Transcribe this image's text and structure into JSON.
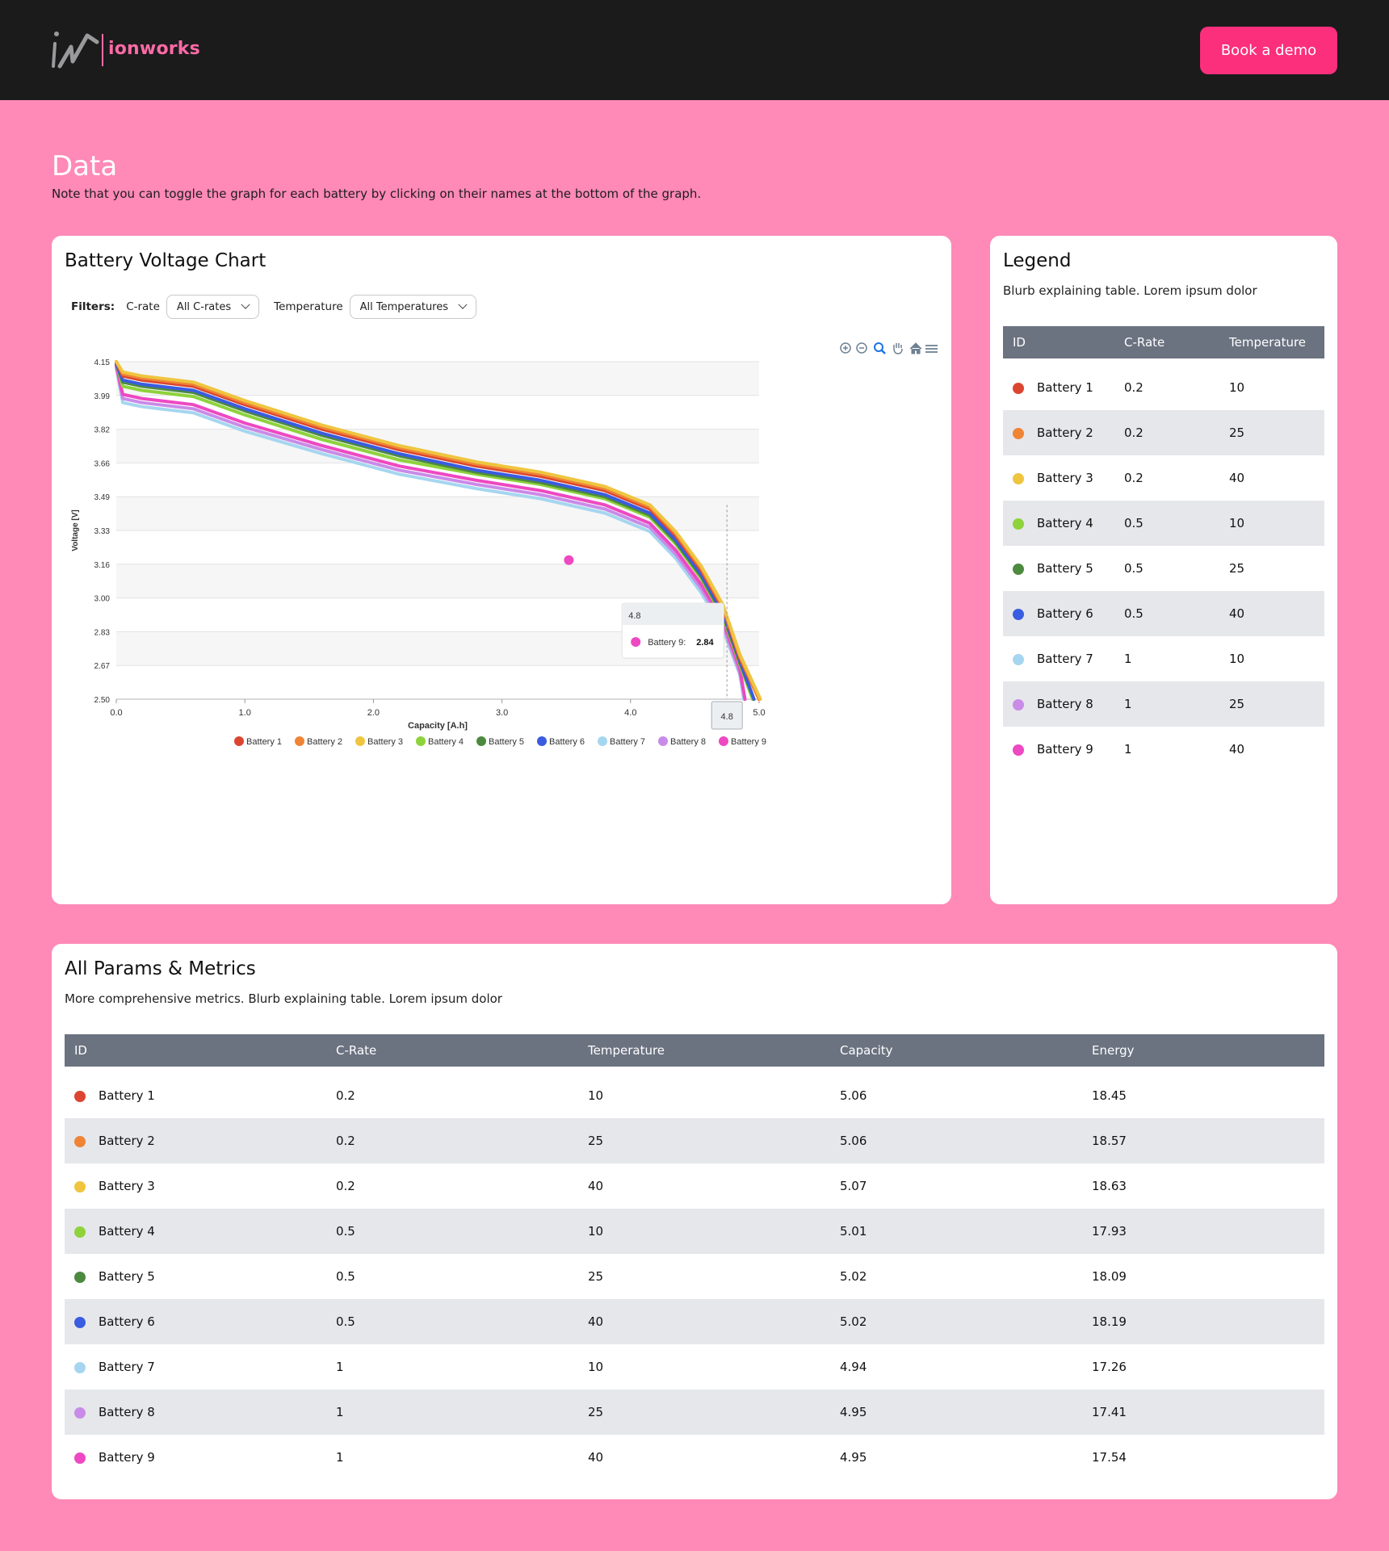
{
  "header": {
    "brand": "ionworks",
    "cta_label": "Book a demo"
  },
  "page": {
    "title": "Data",
    "note": "Note that you can toggle the graph for each battery by clicking on their names at the bottom of the graph."
  },
  "chart_card": {
    "title": "Battery Voltage Chart",
    "filters_label": "Filters:",
    "crate_label": "C-rate",
    "crate_value": "All C-rates",
    "temp_label": "Temperature",
    "temp_value": "All Temperatures",
    "toolbar_icons": [
      "zoom-in-icon",
      "zoom-out-icon",
      "selection-zoom-icon",
      "pan-hand-icon",
      "home-reset-icon",
      "menu-icon"
    ]
  },
  "chart_data": {
    "type": "line",
    "xlabel": "Capacity [A.h]",
    "ylabel": "Voltage [V]",
    "xlim": [
      0,
      5
    ],
    "ylim": [
      2.5,
      4.15
    ],
    "x_ticks": [
      "0.0",
      "1.0",
      "2.0",
      "3.0",
      "4.0",
      "5.0"
    ],
    "y_ticks": [
      "4.15",
      "3.99",
      "3.82",
      "3.66",
      "3.49",
      "3.33",
      "3.16",
      "3.00",
      "2.83",
      "2.67",
      "2.50"
    ],
    "legend_position": "bottom",
    "grid": true,
    "x": [
      0,
      0.05,
      0.2,
      0.6,
      1.0,
      1.6,
      2.2,
      2.8,
      3.3,
      3.8,
      4.15,
      4.35,
      4.55,
      4.72,
      4.85,
      4.95
    ],
    "series": [
      {
        "name": "Battery 1",
        "color": "#dc4530",
        "capacity": 5.06,
        "values": [
          4.15,
          4.08,
          4.06,
          4.03,
          3.94,
          3.82,
          3.72,
          3.64,
          3.59,
          3.52,
          3.43,
          3.3,
          3.13,
          2.94,
          2.7,
          2.5
        ]
      },
      {
        "name": "Battery 2",
        "color": "#ef8435",
        "capacity": 5.06,
        "values": [
          4.15,
          4.09,
          4.07,
          4.04,
          3.95,
          3.83,
          3.73,
          3.65,
          3.6,
          3.53,
          3.44,
          3.31,
          3.14,
          2.95,
          2.71,
          2.5
        ]
      },
      {
        "name": "Battery 3",
        "color": "#efc540",
        "capacity": 5.07,
        "values": [
          4.15,
          4.1,
          4.08,
          4.05,
          3.96,
          3.84,
          3.74,
          3.66,
          3.61,
          3.54,
          3.45,
          3.32,
          3.15,
          2.96,
          2.72,
          2.5
        ]
      },
      {
        "name": "Battery 4",
        "color": "#8ed23c",
        "capacity": 5.01,
        "values": [
          4.14,
          4.03,
          4.01,
          3.98,
          3.89,
          3.77,
          3.67,
          3.6,
          3.55,
          3.48,
          3.39,
          3.26,
          3.09,
          2.9,
          2.67,
          2.5
        ]
      },
      {
        "name": "Battery 5",
        "color": "#4c8a3f",
        "capacity": 5.02,
        "values": [
          4.14,
          4.05,
          4.03,
          4.0,
          3.91,
          3.79,
          3.69,
          3.61,
          3.56,
          3.49,
          3.4,
          3.27,
          3.1,
          2.91,
          2.68,
          2.5
        ]
      },
      {
        "name": "Battery 6",
        "color": "#3a5ce0",
        "capacity": 5.02,
        "values": [
          4.14,
          4.06,
          4.04,
          4.01,
          3.92,
          3.8,
          3.7,
          3.62,
          3.57,
          3.5,
          3.41,
          3.28,
          3.11,
          2.92,
          2.69,
          2.5
        ]
      },
      {
        "name": "Battery 7",
        "color": "#a6d6ef",
        "capacity": 4.94,
        "values": [
          4.12,
          3.95,
          3.93,
          3.9,
          3.81,
          3.7,
          3.6,
          3.53,
          3.48,
          3.41,
          3.32,
          3.19,
          3.02,
          2.84,
          2.62,
          2.5
        ]
      },
      {
        "name": "Battery 8",
        "color": "#c98be8",
        "capacity": 4.95,
        "values": [
          4.13,
          3.97,
          3.95,
          3.92,
          3.83,
          3.72,
          3.62,
          3.55,
          3.5,
          3.43,
          3.34,
          3.21,
          3.04,
          2.86,
          2.63,
          2.5
        ]
      },
      {
        "name": "Battery 9",
        "color": "#ee48c2",
        "capacity": 4.95,
        "values": [
          4.13,
          3.99,
          3.97,
          3.94,
          3.85,
          3.74,
          3.64,
          3.57,
          3.52,
          3.45,
          3.36,
          3.23,
          3.06,
          2.88,
          2.65,
          2.5
        ]
      }
    ],
    "tooltip": {
      "x_label": "4.8",
      "series": "Battery 9:",
      "value": "2.84"
    },
    "crosshair_x": 4.75,
    "crosshair_label": "4.8",
    "marker_point": {
      "x": 3.52,
      "y": 3.18
    }
  },
  "legend_card": {
    "title": "Legend",
    "subtitle": "Blurb explaining table. Lorem ipsum dolor",
    "columns": [
      "ID",
      "C-Rate",
      "Temperature"
    ],
    "rows": [
      {
        "id": "Battery 1",
        "crate": "0.2",
        "temp": "10",
        "color": "#dc4530"
      },
      {
        "id": "Battery 2",
        "crate": "0.2",
        "temp": "25",
        "color": "#ef8435"
      },
      {
        "id": "Battery 3",
        "crate": "0.2",
        "temp": "40",
        "color": "#efc540"
      },
      {
        "id": "Battery 4",
        "crate": "0.5",
        "temp": "10",
        "color": "#8ed23c"
      },
      {
        "id": "Battery 5",
        "crate": "0.5",
        "temp": "25",
        "color": "#4c8a3f"
      },
      {
        "id": "Battery 6",
        "crate": "0.5",
        "temp": "40",
        "color": "#3a5ce0"
      },
      {
        "id": "Battery 7",
        "crate": "1",
        "temp": "10",
        "color": "#a6d6ef"
      },
      {
        "id": "Battery 8",
        "crate": "1",
        "temp": "25",
        "color": "#c98be8"
      },
      {
        "id": "Battery 9",
        "crate": "1",
        "temp": "40",
        "color": "#ee48c2"
      }
    ]
  },
  "metrics_card": {
    "title": "All Params & Metrics",
    "subtitle": "More comprehensive metrics. Blurb explaining table. Lorem ipsum dolor",
    "columns": [
      "ID",
      "C-Rate",
      "Temperature",
      "Capacity",
      "Energy"
    ],
    "rows": [
      {
        "id": "Battery 1",
        "crate": "0.2",
        "temp": "10",
        "capacity": "5.06",
        "energy": "18.45",
        "color": "#dc4530"
      },
      {
        "id": "Battery 2",
        "crate": "0.2",
        "temp": "25",
        "capacity": "5.06",
        "energy": "18.57",
        "color": "#ef8435"
      },
      {
        "id": "Battery 3",
        "crate": "0.2",
        "temp": "40",
        "capacity": "5.07",
        "energy": "18.63",
        "color": "#efc540"
      },
      {
        "id": "Battery 4",
        "crate": "0.5",
        "temp": "10",
        "capacity": "5.01",
        "energy": "17.93",
        "color": "#8ed23c"
      },
      {
        "id": "Battery 5",
        "crate": "0.5",
        "temp": "25",
        "capacity": "5.02",
        "energy": "18.09",
        "color": "#4c8a3f"
      },
      {
        "id": "Battery 6",
        "crate": "0.5",
        "temp": "40",
        "capacity": "5.02",
        "energy": "18.19",
        "color": "#3a5ce0"
      },
      {
        "id": "Battery 7",
        "crate": "1",
        "temp": "10",
        "capacity": "4.94",
        "energy": "17.26",
        "color": "#a6d6ef"
      },
      {
        "id": "Battery 8",
        "crate": "1",
        "temp": "25",
        "capacity": "4.95",
        "energy": "17.41",
        "color": "#c98be8"
      },
      {
        "id": "Battery 9",
        "crate": "1",
        "temp": "40",
        "capacity": "4.95",
        "energy": "17.54",
        "color": "#ee48c2"
      }
    ]
  }
}
